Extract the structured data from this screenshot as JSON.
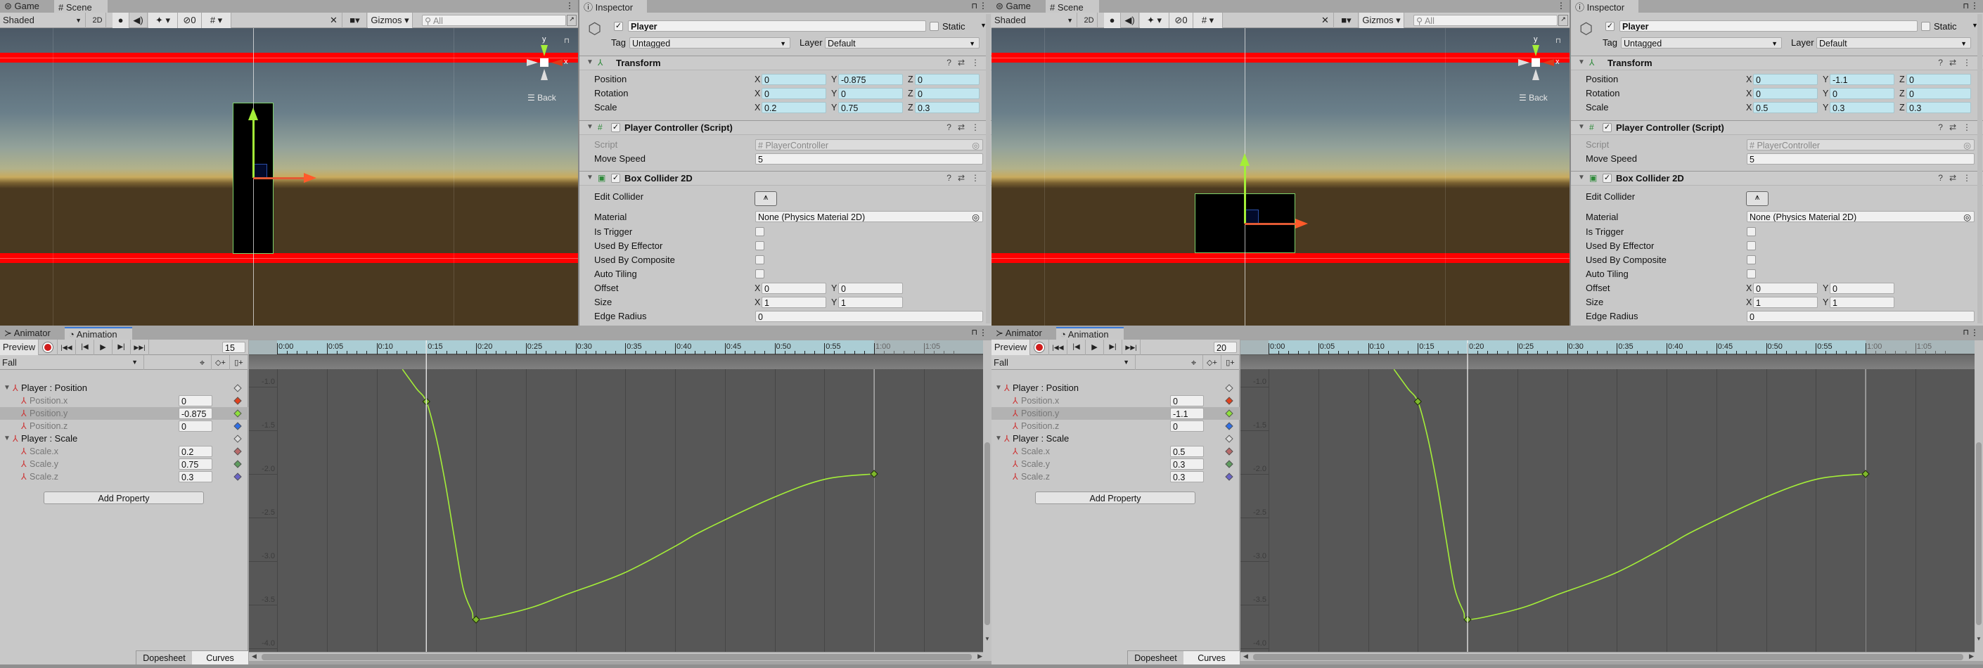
{
  "colors": {
    "curve": "#a4ee38",
    "record": "#d11c1c",
    "ruler": "#abcdd4",
    "curve_bg": "#575757",
    "animated_field": "#c2e6ef",
    "collider_outline": "#7ed36a",
    "red_band": "#ff0000"
  },
  "ui": {
    "scene_tabs": [
      "Game",
      "Scene"
    ],
    "scene_toolbar": {
      "shading": "Shaded",
      "mode_2d": "2D",
      "hidden_count": "0",
      "gizmos": "Gizmos",
      "search_placeholder": "All"
    },
    "scene_gizmo": {
      "y_label": "y",
      "x_label": "x",
      "back_label": "Back"
    },
    "inspector_tab": "Inspector",
    "static_label": "Static",
    "tag_label": "Tag",
    "tag_value": "Untagged",
    "layer_label": "Layer",
    "layer_value": "Default",
    "transform_title": "Transform",
    "transform_rows": [
      "Position",
      "Rotation",
      "Scale"
    ],
    "axes": [
      "X",
      "Y",
      "Z"
    ],
    "script_component_title": "Player Controller (Script)",
    "script_label": "Script",
    "script_value": "PlayerController",
    "move_speed_label": "Move Speed",
    "move_speed_value": "5",
    "collider_title": "Box Collider 2D",
    "edit_collider_label": "Edit Collider",
    "material_label": "Material",
    "material_value": "None (Physics Material 2D)",
    "collider_checks": [
      "Is Trigger",
      "Used By Effector",
      "Used By Composite",
      "Auto Tiling"
    ],
    "offset_label": "Offset",
    "offset": [
      "0",
      "0"
    ],
    "size_label": "Size",
    "size": [
      "1",
      "1"
    ],
    "edge_radius_label": "Edge Radius",
    "edge_radius_value": "0",
    "anim_tabs": [
      "Animator",
      "Animation"
    ],
    "preview_label": "Preview",
    "clip_name": "Fall",
    "group_position": "Player : Position",
    "group_scale": "Player : Scale",
    "position_props": [
      "Position.x",
      "Position.y",
      "Position.z"
    ],
    "scale_props": [
      "Scale.x",
      "Scale.y",
      "Scale.z"
    ],
    "add_property": "Add Property",
    "bottom_tabs": [
      "Dopesheet",
      "Curves"
    ],
    "active_bottom_tab": "Curves"
  },
  "panels": [
    {
      "object_name": "Player",
      "position": [
        "0",
        "-0.875",
        "0"
      ],
      "rotation": [
        "0",
        "0",
        "0"
      ],
      "scale": [
        "0.2",
        "0.75",
        "0.3"
      ],
      "current_frame": "15",
      "position_values": [
        "0",
        "-0.875",
        "0"
      ],
      "scale_values": [
        "0.2",
        "0.75",
        "0.3"
      ]
    },
    {
      "object_name": "Player",
      "position": [
        "0",
        "-1.1",
        "0"
      ],
      "rotation": [
        "0",
        "0",
        "0"
      ],
      "scale": [
        "0.5",
        "0.3",
        "0.3"
      ],
      "current_frame": "20",
      "position_values": [
        "0",
        "-1.1",
        "0"
      ],
      "scale_values": [
        "0.5",
        "0.3",
        "0.3"
      ]
    }
  ],
  "chart_data": {
    "type": "line",
    "x_tick_labels": [
      "0:00",
      "0:05",
      "0:10",
      "0:15",
      "0:20",
      "0:25",
      "0:30",
      "0:35",
      "0:40",
      "0:45",
      "0:50",
      "0:55",
      "1:00",
      "1:05"
    ],
    "x_ticks": [
      0,
      5,
      10,
      15,
      20,
      25,
      30,
      35,
      40,
      45,
      50,
      55,
      60,
      65
    ],
    "clip_end": 60,
    "y_tick_labels": [
      "-1.0",
      "-1.5",
      "-2.0",
      "-2.5",
      "-3.0",
      "-3.5",
      "-4.0"
    ],
    "y_ticks": [
      -1.0,
      -1.5,
      -2.0,
      -2.5,
      -3.0,
      -3.5,
      -4.0
    ],
    "series": [
      {
        "x": [
          12.6,
          14.0,
          15.0,
          15.95,
          16.9,
          17.8,
          18.7,
          19.6,
          20.0,
          22.95,
          25.9,
          28.9,
          34.8,
          40.0,
          42.8,
          49.9,
          55.1,
          60.0
        ],
        "y": [
          -0.8,
          -1.02,
          -1.17,
          -1.56,
          -2.1,
          -2.72,
          -3.31,
          -3.58,
          -3.67,
          -3.61,
          -3.52,
          -3.39,
          -3.14,
          -2.83,
          -2.65,
          -2.27,
          -2.06,
          -2.0
        ]
      }
    ],
    "keyframes": [
      [
        15,
        -1.17
      ],
      [
        20,
        -3.67
      ],
      [
        60,
        -2.0
      ]
    ]
  }
}
